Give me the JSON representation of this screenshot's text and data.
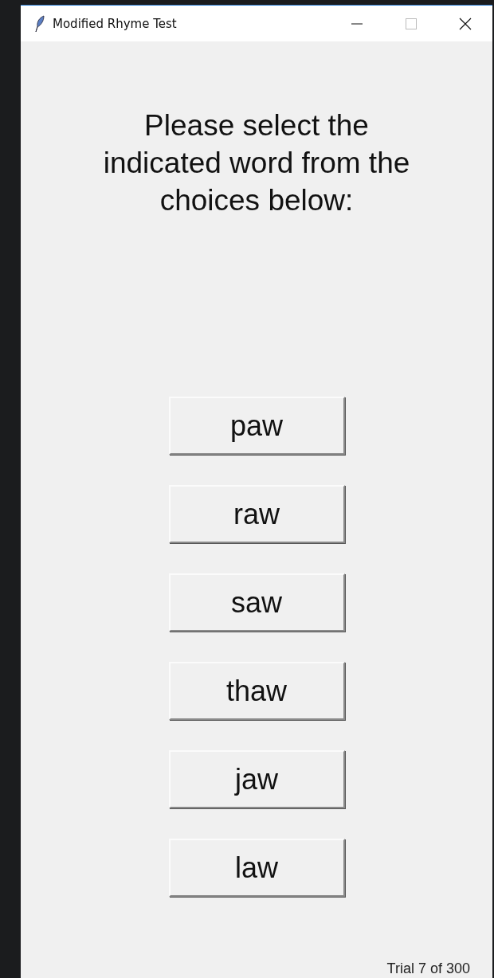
{
  "window": {
    "title": "Modified Rhyme Test"
  },
  "prompt": "Please select the indicated word from the choices below:",
  "choices": [
    "paw",
    "raw",
    "saw",
    "thaw",
    "jaw",
    "law"
  ],
  "status": "Trial 7 of 300"
}
